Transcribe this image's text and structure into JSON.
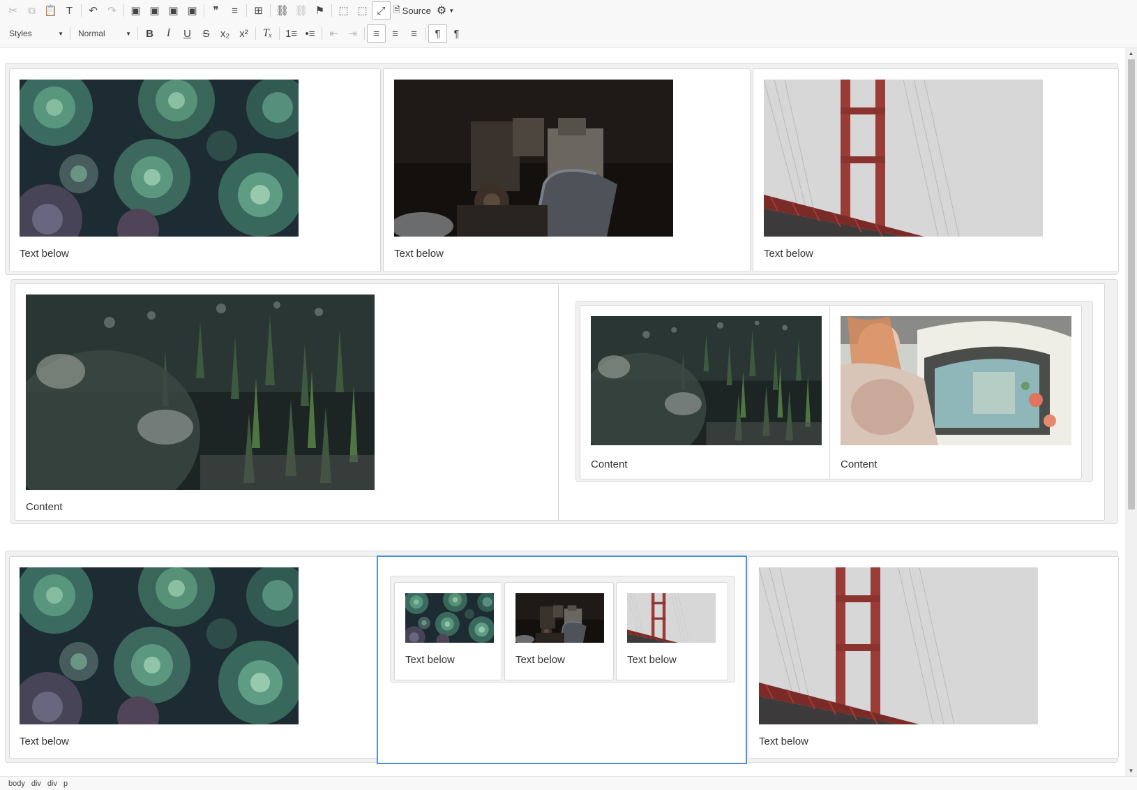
{
  "toolbar": {
    "row1": [
      {
        "name": "cut-icon",
        "glyph": "✂",
        "disabled": true
      },
      {
        "name": "copy-icon",
        "glyph": "⧉",
        "disabled": true
      },
      {
        "name": "paste-icon",
        "glyph": "📋",
        "disabled": false
      },
      {
        "name": "paste-text-icon",
        "glyph": "T",
        "disabled": false
      },
      {
        "name": "sep"
      },
      {
        "name": "undo-icon",
        "glyph": "↶",
        "disabled": false
      },
      {
        "name": "redo-icon",
        "glyph": "↷",
        "disabled": true
      },
      {
        "name": "sep"
      },
      {
        "name": "image-icon",
        "glyph": "▣",
        "disabled": false
      },
      {
        "name": "image-replace-icon",
        "glyph": "▣",
        "disabled": false
      },
      {
        "name": "gallery-icon",
        "glyph": "▣",
        "disabled": false
      },
      {
        "name": "insert-media-icon",
        "glyph": "▣",
        "disabled": false
      },
      {
        "name": "sep"
      },
      {
        "name": "blockquote-icon",
        "glyph": "❞",
        "disabled": false
      },
      {
        "name": "horizontal-rule-icon",
        "glyph": "≡",
        "disabled": false
      },
      {
        "name": "sep"
      },
      {
        "name": "table-icon",
        "glyph": "⊞",
        "disabled": false
      },
      {
        "name": "sep"
      },
      {
        "name": "link-icon",
        "glyph": "⛓",
        "disabled": false
      },
      {
        "name": "unlink-icon",
        "glyph": "⛓",
        "disabled": true
      },
      {
        "name": "anchor-flag-icon",
        "glyph": "⚑",
        "disabled": false
      },
      {
        "name": "sep"
      },
      {
        "name": "select-all-icon",
        "glyph": "⬚",
        "disabled": false
      },
      {
        "name": "show-blocks-icon",
        "glyph": "⬚",
        "disabled": false
      },
      {
        "name": "maximize-icon",
        "glyph": "⤢",
        "disabled": false,
        "active": true
      }
    ],
    "source_label": "Source",
    "styles_label": "Styles",
    "format_label": "Normal",
    "row2": [
      {
        "name": "bold-icon",
        "glyph": "B",
        "cls": "b"
      },
      {
        "name": "italic-icon",
        "glyph": "I",
        "cls": "i"
      },
      {
        "name": "underline-icon",
        "glyph": "U",
        "cls": "u"
      },
      {
        "name": "strikethrough-icon",
        "glyph": "S",
        "cls": "s"
      },
      {
        "name": "subscript-icon",
        "glyph": "x₂",
        "cls": ""
      },
      {
        "name": "superscript-icon",
        "glyph": "x²",
        "cls": ""
      },
      {
        "name": "sep"
      },
      {
        "name": "remove-format-icon",
        "glyph": "Tₓ",
        "cls": "i"
      },
      {
        "name": "sep"
      },
      {
        "name": "numbered-list-icon",
        "glyph": "1≡",
        "cls": ""
      },
      {
        "name": "bulleted-list-icon",
        "glyph": "•≡",
        "cls": ""
      },
      {
        "name": "sep"
      },
      {
        "name": "outdent-icon",
        "glyph": "⇤",
        "cls": "",
        "disabled": true
      },
      {
        "name": "indent-icon",
        "glyph": "⇥",
        "cls": "",
        "disabled": true
      },
      {
        "name": "sep"
      },
      {
        "name": "align-left-icon",
        "glyph": "≡",
        "cls": "",
        "active": true
      },
      {
        "name": "align-center-icon",
        "glyph": "≡",
        "cls": ""
      },
      {
        "name": "align-right-icon",
        "glyph": "≡",
        "cls": ""
      },
      {
        "name": "sep"
      },
      {
        "name": "ltr-icon",
        "glyph": "¶",
        "cls": "",
        "active": true
      },
      {
        "name": "rtl-icon",
        "glyph": "¶",
        "cls": ""
      }
    ]
  },
  "content": {
    "row1": [
      "Text below",
      "Text below",
      "Text below"
    ],
    "row2": {
      "left": "Content",
      "nested": [
        "Content",
        "Content"
      ]
    },
    "row3": {
      "left": "Text below",
      "nested": [
        "Text below",
        "Text below",
        "Text below"
      ],
      "right": "Text below"
    }
  },
  "statusbar": {
    "path": [
      "body",
      "div",
      "div",
      "p"
    ]
  },
  "colors": {
    "selection": "#4a90d9"
  }
}
